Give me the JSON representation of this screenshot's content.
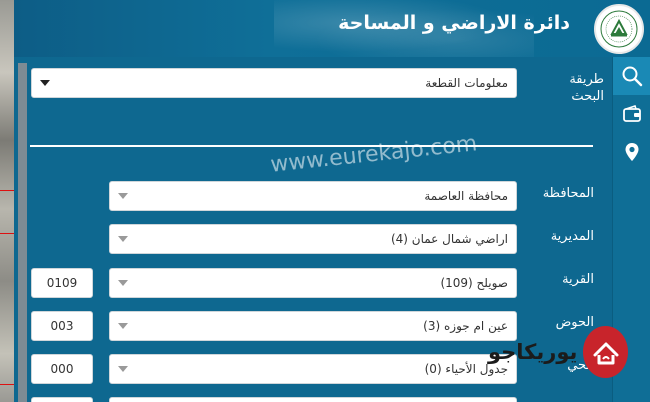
{
  "header": {
    "title": "دائرة الاراضي و المساحة"
  },
  "search_method": {
    "label": "طريقة البحث",
    "value": "معلومات القطعة"
  },
  "fields": [
    {
      "label": "المحافظة",
      "value": "محافظة العاصمة",
      "code": ""
    },
    {
      "label": "المديرية",
      "value": "اراضي شمال عمان (4)",
      "code": ""
    },
    {
      "label": "القرية",
      "value": "صويلح (109)",
      "code": "0109"
    },
    {
      "label": "الحوض",
      "value": "عين ام جوزه (3)",
      "code": "003"
    },
    {
      "label": "الحي",
      "value": "جدول الأحياء (0)",
      "code": "000"
    }
  ],
  "watermark": "www.eurekajo.com",
  "badge": {
    "text": "يوريكاجو"
  },
  "icons": [
    "search-icon",
    "wallet-icon",
    "location-pin-icon"
  ],
  "colors": {
    "primary": "#0f6e96",
    "accent": "#c8242b"
  }
}
